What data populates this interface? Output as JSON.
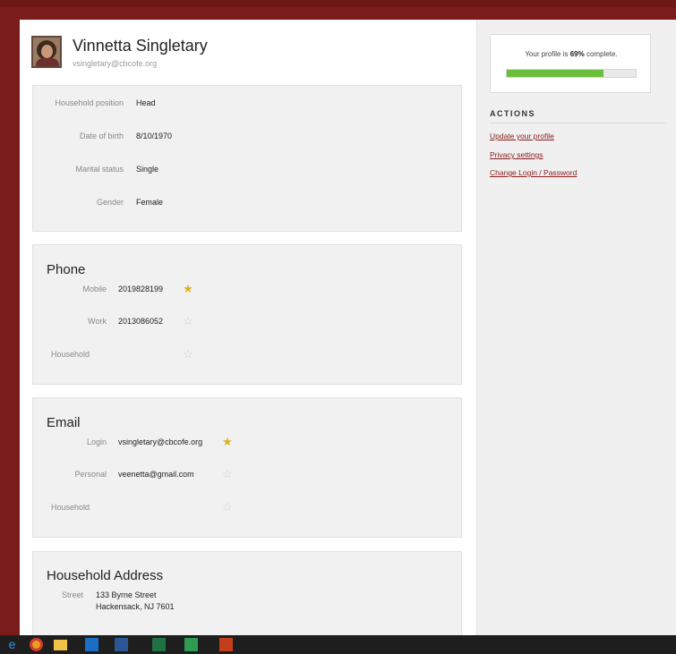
{
  "profile": {
    "name": "Vinnetta Singletary",
    "email": "vsingletary@cbcofe.org"
  },
  "details": {
    "household_position_label": "Household position",
    "household_position_value": "Head",
    "dob_label": "Date of birth",
    "dob_value": "8/10/1970",
    "marital_label": "Marital status",
    "marital_value": "Single",
    "gender_label": "Gender",
    "gender_value": "Female"
  },
  "phone": {
    "title": "Phone",
    "rows": [
      {
        "label": "Mobile",
        "value": "2019828199",
        "primary": true
      },
      {
        "label": "Work",
        "value": "2013086052",
        "primary": false
      },
      {
        "label": "Household",
        "value": "",
        "primary": false
      }
    ]
  },
  "email_section": {
    "title": "Email",
    "rows": [
      {
        "label": "Login",
        "value": "vsingletary@cbcofe.org",
        "primary": true
      },
      {
        "label": "Personal",
        "value": "veenetta@gmail.com",
        "primary": false
      },
      {
        "label": "Household",
        "value": "",
        "primary": false
      }
    ]
  },
  "address": {
    "title": "Household Address",
    "street_label": "Street",
    "street_line1": "133 Byrne Street",
    "street_line2": "Hackensack, NJ 7601"
  },
  "sidebar": {
    "progress_prefix": "Your profile is ",
    "progress_percent_text": "69%",
    "progress_suffix": " complete.",
    "progress_fraction": 0.75,
    "actions_title": "ACTIONS",
    "links": [
      "Update your profile",
      "Privacy settings",
      "Change Login / Password"
    ]
  },
  "icons": {
    "star_on": "★",
    "star_off": "☆"
  },
  "colors": {
    "accent_link": "#8b1a1a",
    "progress_green": "#6cbf3c",
    "star_gold": "#d9b21b"
  }
}
